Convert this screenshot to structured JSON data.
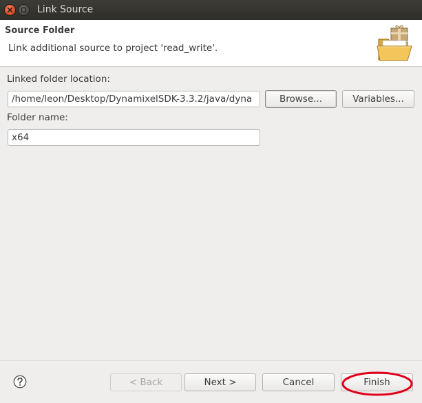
{
  "window": {
    "title": "Link Source"
  },
  "banner": {
    "title": "Source Folder",
    "description": "Link additional source to project 'read_write'.",
    "icon": "folder-with-package-icon"
  },
  "form": {
    "linked_folder_label": "Linked folder location:",
    "linked_folder_value": "/home/leon/Desktop/DynamixelSDK-3.3.2/java/dyna",
    "browse_label": "Browse...",
    "variables_label": "Variables...",
    "folder_name_label": "Folder name:",
    "folder_name_value": "x64"
  },
  "footer": {
    "help_icon": "help-icon",
    "back_label": "< Back",
    "next_label": "Next >",
    "cancel_label": "Cancel",
    "finish_label": "Finish"
  },
  "annotation": {
    "color": "#e0001b",
    "target": "finish-button"
  }
}
